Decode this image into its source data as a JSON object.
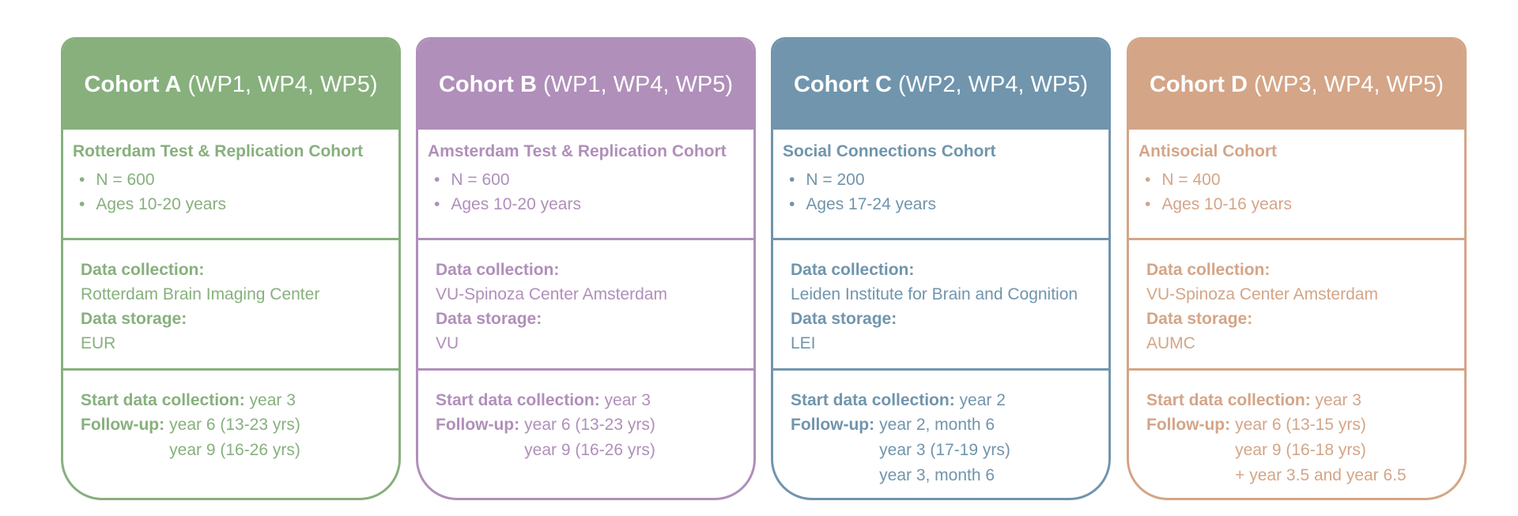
{
  "labels": {
    "data_collection": "Data collection:",
    "data_storage": "Data storage:",
    "start": "Start data collection:",
    "follow_up": "Follow-up:"
  },
  "cohorts": [
    {
      "title": "Cohort A",
      "wps": "(WP1, WP4, WP5)",
      "color": "#87b07d",
      "name": "Rotterdam Test & Replication Cohort",
      "bullets": [
        "N = 600",
        "Ages 10-20 years"
      ],
      "collection": "Rotterdam Brain Imaging Center",
      "storage": "EUR",
      "start": "year 3",
      "follow_up": [
        "year 6 (13-23 yrs)",
        "year 9 (16-26 yrs)"
      ]
    },
    {
      "title": "Cohort B",
      "wps": "(WP1, WP4, WP5)",
      "color": "#b08fba",
      "name": "Amsterdam Test & Replication Cohort",
      "bullets": [
        "N = 600",
        "Ages 10-20 years"
      ],
      "collection": "VU-Spinoza Center Amsterdam",
      "storage": "VU",
      "start": "year 3",
      "follow_up": [
        "year 6 (13-23 yrs)",
        "year 9 (16-26 yrs)"
      ]
    },
    {
      "title": "Cohort C",
      "wps": "(WP2, WP4, WP5)",
      "color": "#7095ad",
      "name": "Social Connections Cohort",
      "bullets": [
        "N = 200",
        "Ages 17-24  years"
      ],
      "collection": "Leiden Institute for Brain and Cognition",
      "storage": "LEI",
      "start": "year 2",
      "follow_up": [
        "year 2, month 6",
        "year 3 (17-19 yrs)",
        "year 3, month 6"
      ]
    },
    {
      "title": "Cohort D",
      "wps": "(WP3, WP4, WP5)",
      "color": "#d4a587",
      "name": "Antisocial Cohort",
      "bullets": [
        "N = 400",
        "Ages 10-16 years"
      ],
      "collection": "VU-Spinoza Center Amsterdam",
      "storage": "AUMC",
      "start": "year 3",
      "follow_up": [
        "year 6 (13-15 yrs)",
        "year 9 (16-18 yrs)",
        "+ year 3.5 and year 6.5"
      ]
    }
  ]
}
